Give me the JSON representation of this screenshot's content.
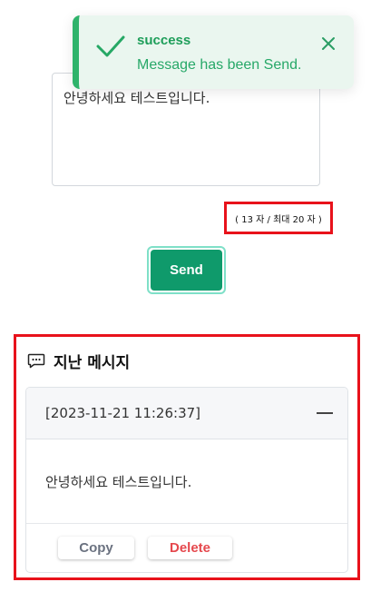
{
  "composer": {
    "text": "안녕하세요 테스트입니다.",
    "counter": "( 13 자 / 최대 20 자 )",
    "send_label": "Send"
  },
  "toast": {
    "title": "success",
    "message": "Message has been Send.",
    "icon": "check-icon",
    "close_icon": "close-icon",
    "accent": "#2fb36b"
  },
  "history": {
    "title": "지난 메시지",
    "icon": "chat-icon",
    "items": [
      {
        "timestamp": "[2023-11-21 11:26:37]",
        "message": "안녕하세요 테스트입니다.",
        "copy_label": "Copy",
        "delete_label": "Delete"
      }
    ]
  },
  "colors": {
    "primary": "#0f9a6b",
    "danger": "#e5484d",
    "highlight": "#e8121b"
  }
}
